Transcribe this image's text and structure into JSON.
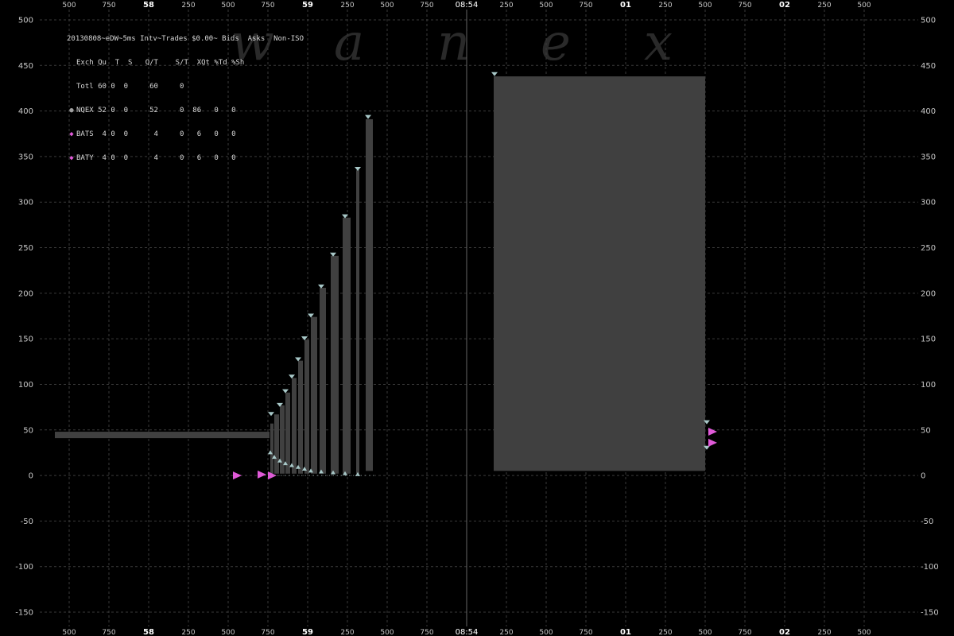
{
  "legend": {
    "title": "20130808~eDW~5ms Intv~Trades $0.00~ Bids  Asks  Non-ISO",
    "header": "Exch Qu  T  S   Q/T    S/T  XQt %Td %Sh",
    "rows": [
      {
        "symbol": "",
        "color": "#d8d8d8",
        "text": "Totl 60 0  0     60     0"
      },
      {
        "symbol": "●",
        "color": "#a0a0a0",
        "text": "NQEX 52 0  0     52     0  86   0   0"
      },
      {
        "symbol": "◆",
        "color": "#e05ad8",
        "text": "BATS  4 0  0      4     0   6   0   0"
      },
      {
        "symbol": "◆",
        "color": "#e05ad8",
        "text": "BATY  4 0  0      4     0   6   0   0"
      }
    ]
  },
  "watermark": [
    "w",
    "a",
    "n",
    "e",
    "x"
  ],
  "axis": {
    "x_ticks": [
      {
        "label": "500",
        "kind": "minor"
      },
      {
        "label": "750",
        "kind": "minor"
      },
      {
        "label": "58",
        "kind": "major"
      },
      {
        "label": "250",
        "kind": "minor"
      },
      {
        "label": "500",
        "kind": "minor"
      },
      {
        "label": "750",
        "kind": "minor"
      },
      {
        "label": "59",
        "kind": "major"
      },
      {
        "label": "250",
        "kind": "minor"
      },
      {
        "label": "500",
        "kind": "minor"
      },
      {
        "label": "750",
        "kind": "minor"
      },
      {
        "label": "08:54",
        "kind": "time"
      },
      {
        "label": "250",
        "kind": "minor"
      },
      {
        "label": "500",
        "kind": "minor"
      },
      {
        "label": "750",
        "kind": "minor"
      },
      {
        "label": "01",
        "kind": "major"
      },
      {
        "label": "250",
        "kind": "minor"
      },
      {
        "label": "500",
        "kind": "minor"
      },
      {
        "label": "750",
        "kind": "minor"
      },
      {
        "label": "02",
        "kind": "major"
      },
      {
        "label": "250",
        "kind": "minor"
      },
      {
        "label": "500",
        "kind": "minor"
      }
    ],
    "y_ticks": [
      500,
      450,
      400,
      350,
      300,
      250,
      200,
      150,
      100,
      50,
      0,
      -50,
      -100,
      -150
    ]
  },
  "chart_data": {
    "type": "bar",
    "title": "",
    "xlabel": "",
    "ylabel": "",
    "x_unit": "seconds after 08:53:57",
    "ylim": [
      -150,
      500
    ],
    "xlim": [
      0.5,
      5.5
    ],
    "grid": true,
    "legend_position": "top-left",
    "colors": {
      "bar": "#404040",
      "nqex": "#a8c8c8",
      "bats": "#e05ad8",
      "divider": "#666666"
    },
    "divider_x": 3.0,
    "series": [
      {
        "name": "NQEX",
        "bars": [
          {
            "x0": 0.41,
            "x1": 1.76,
            "y0": 41,
            "y1": 48
          },
          {
            "x0": 1.765,
            "x1": 1.785,
            "y0": 2,
            "y1": 57
          },
          {
            "x0": 1.79,
            "x1": 1.82,
            "y0": 2,
            "y1": 67
          },
          {
            "x0": 1.825,
            "x1": 1.855,
            "y0": 2,
            "y1": 77
          },
          {
            "x0": 1.86,
            "x1": 1.89,
            "y0": 2,
            "y1": 91
          },
          {
            "x0": 1.9,
            "x1": 1.93,
            "y0": 2,
            "y1": 107
          },
          {
            "x0": 1.94,
            "x1": 1.97,
            "y0": 2,
            "y1": 126
          },
          {
            "x0": 1.98,
            "x1": 2.01,
            "y0": 2,
            "y1": 149
          },
          {
            "x0": 2.02,
            "x1": 2.06,
            "y0": 2,
            "y1": 174
          },
          {
            "x0": 2.075,
            "x1": 2.115,
            "y0": 2,
            "y1": 206
          },
          {
            "x0": 2.145,
            "x1": 2.195,
            "y0": 2,
            "y1": 241
          },
          {
            "x0": 2.22,
            "x1": 2.27,
            "y0": 2,
            "y1": 283
          },
          {
            "x0": 2.305,
            "x1": 2.325,
            "y0": 2,
            "y1": 335
          },
          {
            "x0": 2.365,
            "x1": 2.41,
            "y0": 5,
            "y1": 391
          },
          {
            "x0": 3.17,
            "x1": 4.5,
            "y0": 5,
            "y1": 438
          }
        ],
        "ask_markers": [
          {
            "x": 1.77,
            "y": 67
          },
          {
            "x": 1.825,
            "y": 77
          },
          {
            "x": 1.86,
            "y": 92
          },
          {
            "x": 1.9,
            "y": 108
          },
          {
            "x": 1.94,
            "y": 127
          },
          {
            "x": 1.98,
            "y": 150
          },
          {
            "x": 2.02,
            "y": 175
          },
          {
            "x": 2.085,
            "y": 207
          },
          {
            "x": 2.16,
            "y": 242
          },
          {
            "x": 2.235,
            "y": 284
          },
          {
            "x": 2.315,
            "y": 336
          },
          {
            "x": 2.38,
            "y": 393
          },
          {
            "x": 3.175,
            "y": 440
          },
          {
            "x": 4.51,
            "y": 58
          },
          {
            "x": 4.51,
            "y": 30
          }
        ],
        "bid_markers": [
          {
            "x": 1.765,
            "y": 25
          },
          {
            "x": 1.79,
            "y": 20
          },
          {
            "x": 1.825,
            "y": 16
          },
          {
            "x": 1.86,
            "y": 13
          },
          {
            "x": 1.9,
            "y": 11
          },
          {
            "x": 1.94,
            "y": 9
          },
          {
            "x": 1.98,
            "y": 7
          },
          {
            "x": 2.02,
            "y": 5
          },
          {
            "x": 2.085,
            "y": 4
          },
          {
            "x": 2.16,
            "y": 3
          },
          {
            "x": 2.235,
            "y": 2
          },
          {
            "x": 2.315,
            "y": 1
          }
        ]
      },
      {
        "name": "BATS",
        "points": [
          {
            "x": 1.55,
            "y": 0
          },
          {
            "x": 1.705,
            "y": 1
          },
          {
            "x": 1.77,
            "y": 0
          },
          {
            "x": 4.54,
            "y": 48
          },
          {
            "x": 4.54,
            "y": 36
          }
        ]
      }
    ]
  }
}
